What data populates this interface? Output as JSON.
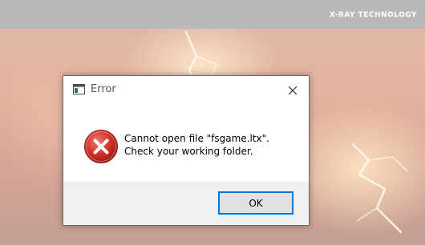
{
  "splash": {
    "logo_text": "X-RAY TECHNOLOGY"
  },
  "dialog": {
    "title": "Error",
    "title_icon": "window-icon",
    "close_icon": "close-icon",
    "error_icon": "error-icon",
    "message_line1": "Cannot open file \"fsgame.ltx\".",
    "message_line2": "Check your working folder.",
    "ok_label": "OK"
  },
  "colors": {
    "accent_border": "#0078d7",
    "error_red": "#d32f2f",
    "footer_bg": "#f0f0f0"
  }
}
